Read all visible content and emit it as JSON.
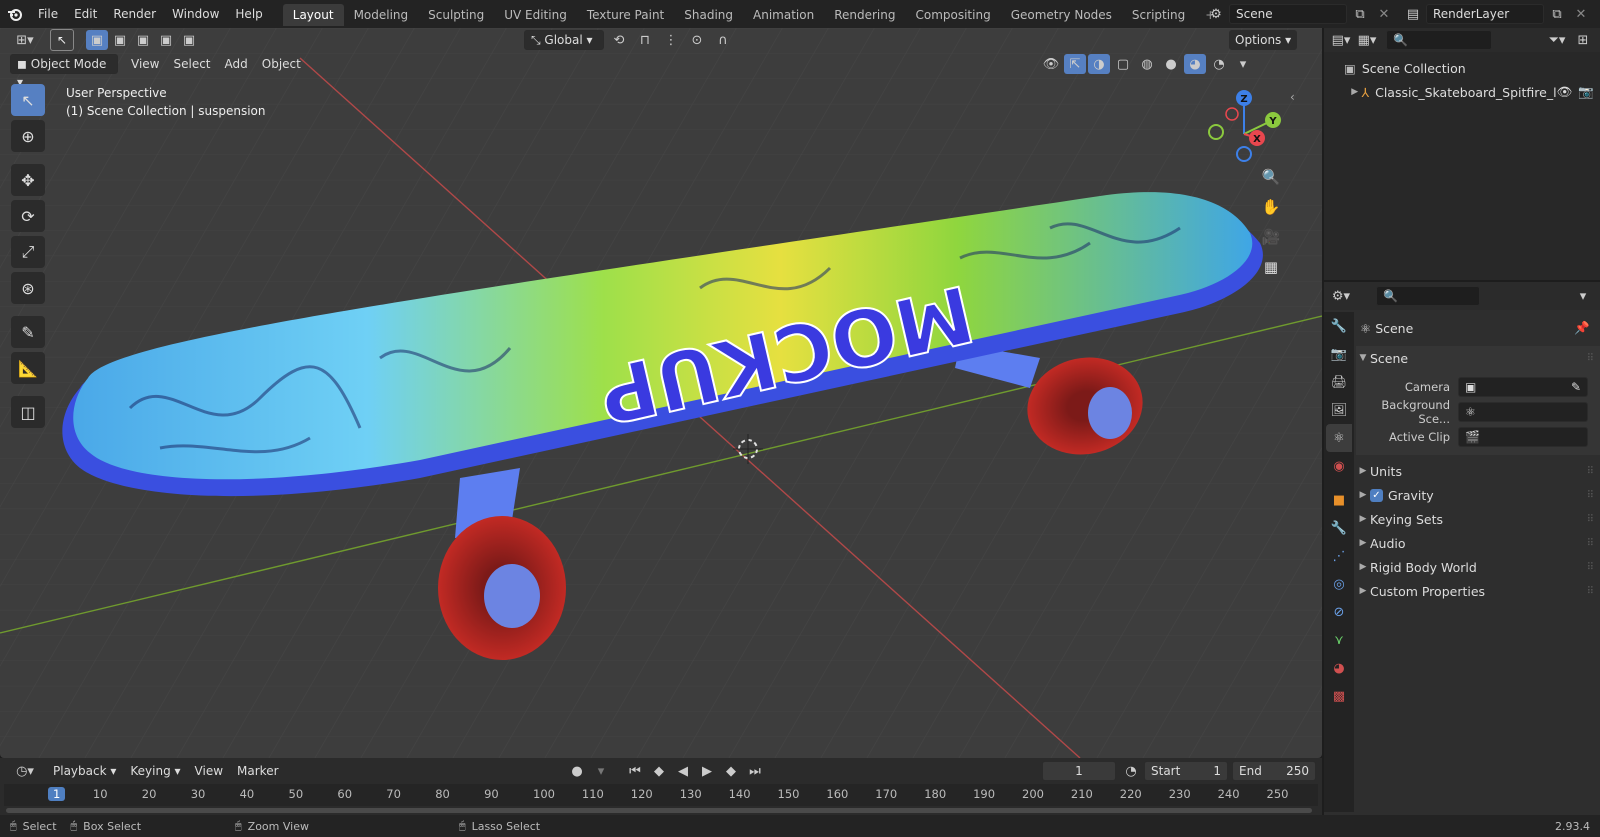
{
  "topbar": {
    "menus": [
      "File",
      "Edit",
      "Render",
      "Window",
      "Help"
    ],
    "workspaces": [
      "Layout",
      "Modeling",
      "Sculpting",
      "UV Editing",
      "Texture Paint",
      "Shading",
      "Animation",
      "Rendering",
      "Compositing",
      "Geometry Nodes",
      "Scripting"
    ],
    "active_workspace": "Layout",
    "add_tab": "+",
    "scene_name": "Scene",
    "view_layer_name": "RenderLayer"
  },
  "viewport": {
    "transform_orientation": "Global",
    "options_label": "Options",
    "mode": "Object Mode",
    "menus": [
      "View",
      "Select",
      "Add",
      "Object"
    ],
    "overlay_line1": "User Perspective",
    "overlay_line2": "(1) Scene Collection | suspension",
    "gizmo": {
      "z": "Z",
      "y": "Y",
      "x": "X"
    },
    "deck_text": "MOCKUP"
  },
  "timeline": {
    "menus": [
      "Playback",
      "Keying",
      "View",
      "Marker"
    ],
    "current_frame": "1",
    "start_label": "Start",
    "start_value": "1",
    "end_label": "End",
    "end_value": "250",
    "ruler": [
      "1",
      "10",
      "20",
      "30",
      "40",
      "50",
      "60",
      "70",
      "80",
      "90",
      "100",
      "110",
      "120",
      "130",
      "140",
      "150",
      "160",
      "170",
      "180",
      "190",
      "200",
      "210",
      "220",
      "230",
      "240",
      "250"
    ]
  },
  "statusbar": {
    "select": "Select",
    "box_select": "Box Select",
    "zoom_view": "Zoom View",
    "lasso_select": "Lasso Select",
    "version": "2.93.4"
  },
  "outliner": {
    "root": "Scene Collection",
    "items": [
      {
        "label": "Classic_Skateboard_Spitfire_l"
      }
    ]
  },
  "properties": {
    "context": "Scene",
    "panel_title": "Scene",
    "fields": [
      {
        "label": "Camera"
      },
      {
        "label": "Background Sce..."
      },
      {
        "label": "Active Clip"
      }
    ],
    "subpanels": [
      "Units",
      "Gravity",
      "Keying Sets",
      "Audio",
      "Rigid Body World",
      "Custom Properties"
    ],
    "gravity_checked": true
  },
  "colors": {
    "accent": "#4f7fc1",
    "viewport_bg": "#3d3d3d",
    "axis_x": "#e8474e",
    "axis_y": "#8bc93e",
    "axis_z": "#3d80e8",
    "deck_edge": "#3a4fe0",
    "wheel": "#b3231f"
  }
}
